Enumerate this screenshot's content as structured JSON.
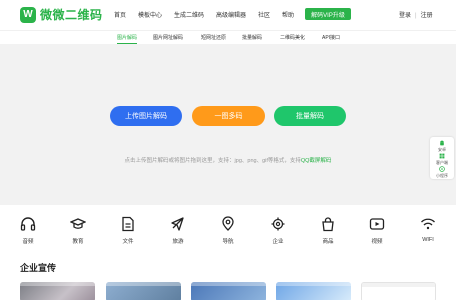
{
  "header": {
    "logo_mark": "W",
    "logo_text": "微微二维码",
    "nav": [
      "首页",
      "模板中心",
      "生成二维码",
      "高级编辑器",
      "社区",
      "帮助"
    ],
    "vip_label": "解码VIP升级",
    "login": "登录",
    "separator": "|",
    "register": "注册"
  },
  "subnav": {
    "items": [
      "图片解码",
      "图片网址解码",
      "短网址还原",
      "批量解码",
      "二维码美化",
      "API接口"
    ],
    "active_index": 0
  },
  "hero": {
    "buttons": [
      "上传图片解码",
      "一图多码",
      "批量解码"
    ],
    "hint_prefix": "点击上传图片解码或将图片拖到这里，支持：jpg、png、gif等格式，支持",
    "hint_link": "QQ截屏解码"
  },
  "float_panel": {
    "items": [
      "安卓",
      "客户端",
      "小程序"
    ]
  },
  "categories": [
    {
      "label": "音频",
      "icon": "headphones-icon"
    },
    {
      "label": "教育",
      "icon": "graduation-cap-icon"
    },
    {
      "label": "文件",
      "icon": "document-icon"
    },
    {
      "label": "旅游",
      "icon": "airplane-icon"
    },
    {
      "label": "导航",
      "icon": "map-pin-icon"
    },
    {
      "label": "企业",
      "icon": "gear-icon"
    },
    {
      "label": "商品",
      "icon": "bag-icon"
    },
    {
      "label": "视频",
      "icon": "video-icon"
    },
    {
      "label": "WIFI",
      "icon": "wifi-icon"
    }
  ],
  "section": {
    "title": "企业宣传"
  },
  "colors": {
    "brand_green": "#2bb34a",
    "button_blue": "#2f6ef0",
    "button_orange": "#ff9a1a",
    "button_green": "#1fc66b",
    "hero_bg": "#f2f2f2"
  }
}
